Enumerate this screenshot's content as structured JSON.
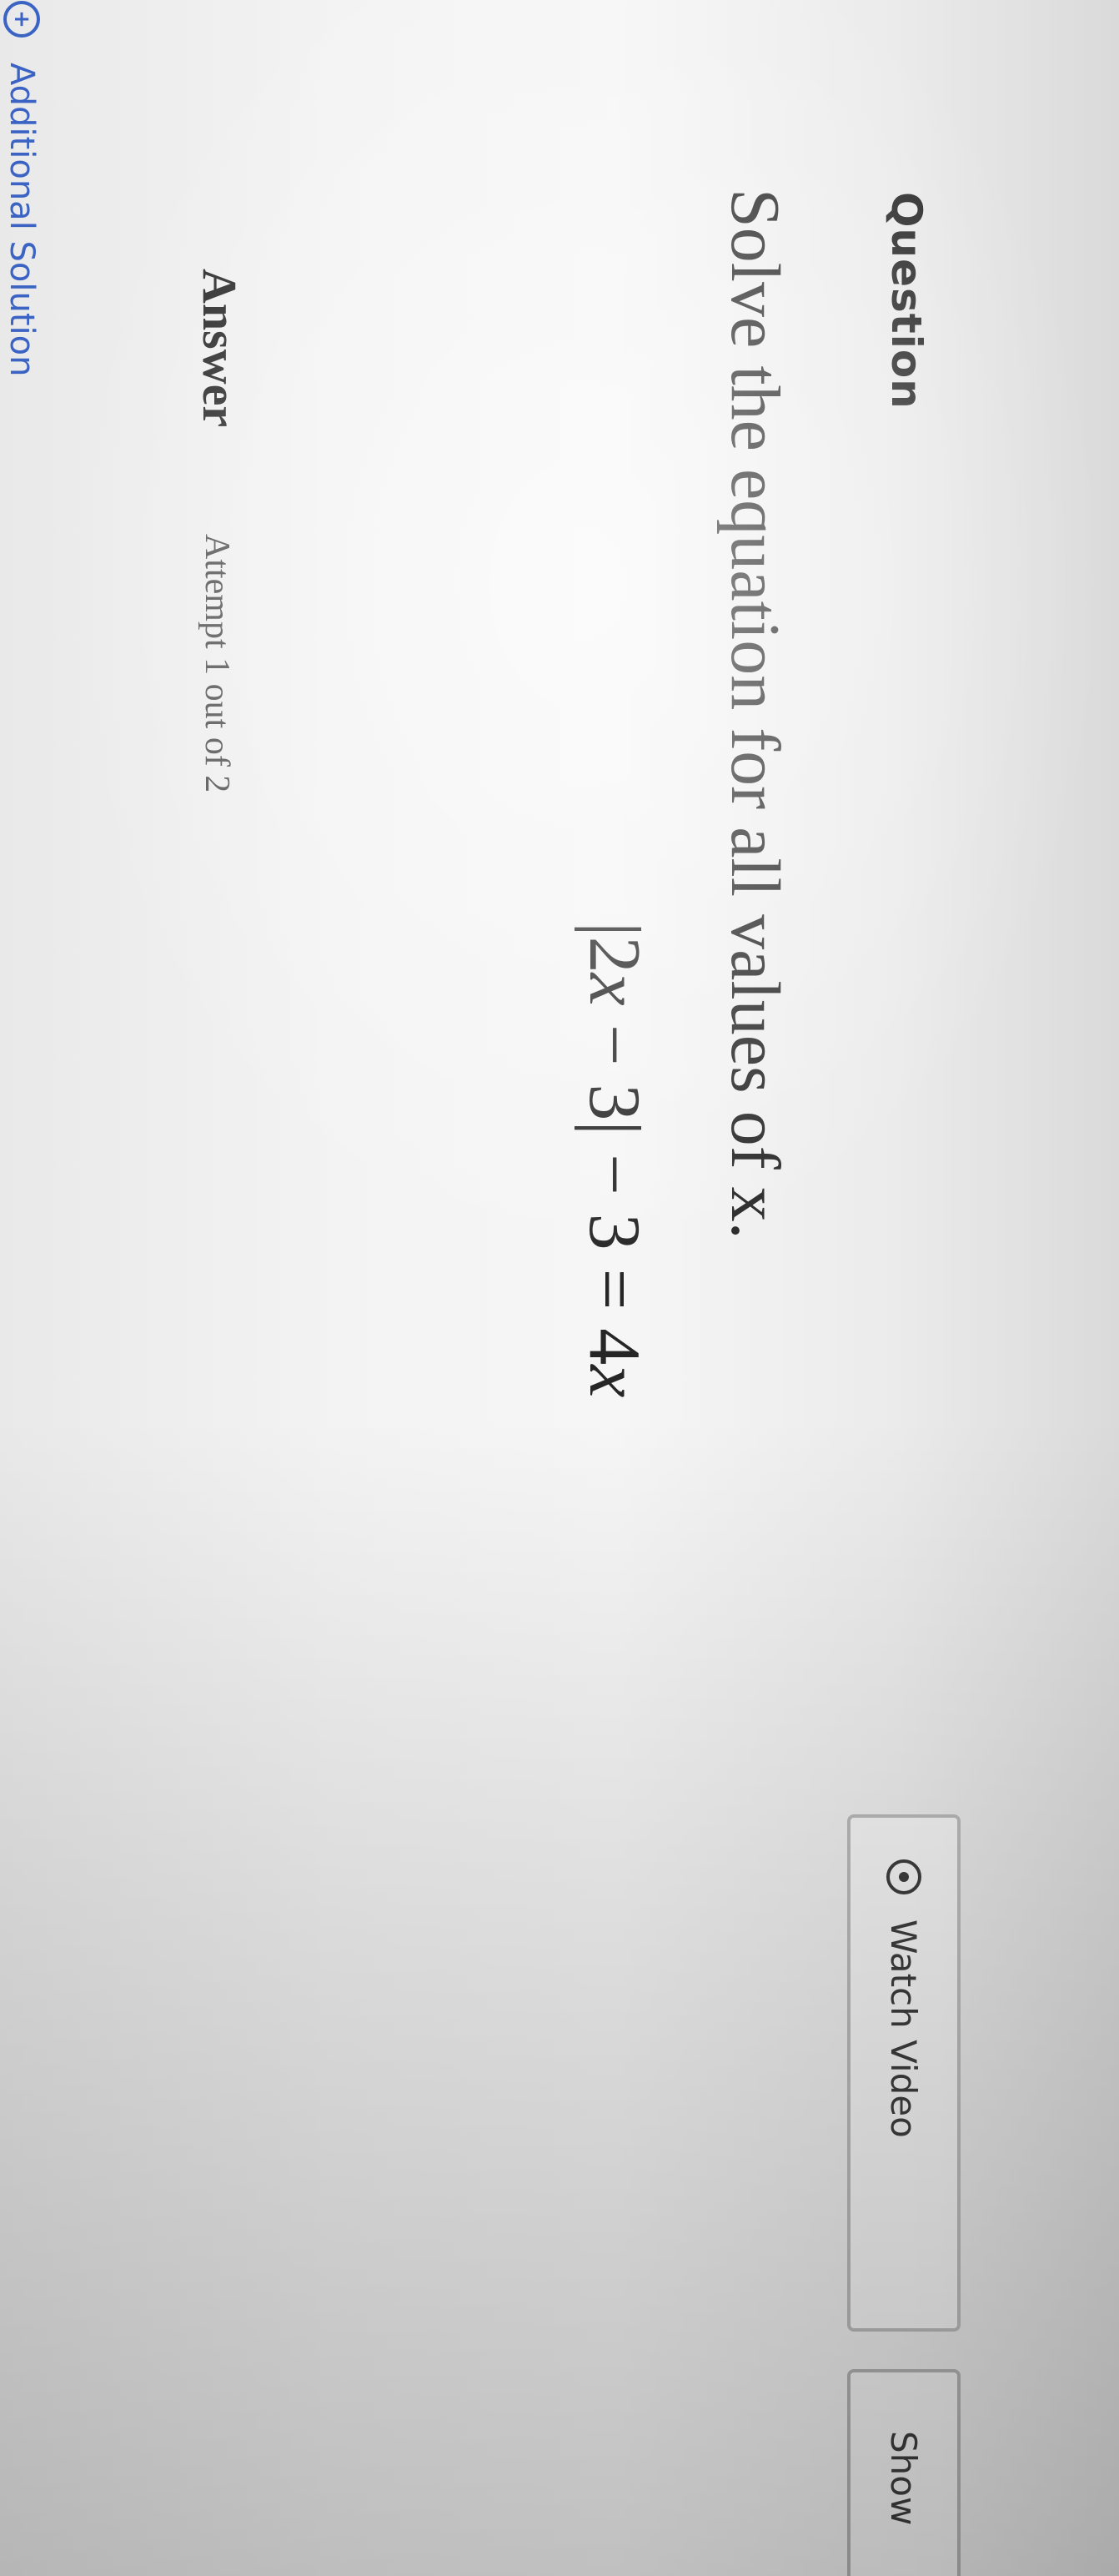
{
  "question": {
    "heading": "Question",
    "prompt": "Solve the equation for all values of x.",
    "equation": {
      "abs_open": "|",
      "coef1": "2",
      "var1": "x",
      "minus1": " − 3",
      "abs_close": "|",
      "minus2": " − 3 = 4",
      "var2": "x"
    }
  },
  "answer": {
    "label": "Answer",
    "attempt": "Attempt 1 out of 2"
  },
  "additional_solution": {
    "label": "Additional Solution",
    "icon": "plus-circle-icon"
  },
  "actions": {
    "watch_video": "Watch Video",
    "watch_video_icon": "play-circle-icon",
    "show": "Show"
  },
  "colors": {
    "link": "#3a63c4",
    "text": "#2b2b2b"
  }
}
